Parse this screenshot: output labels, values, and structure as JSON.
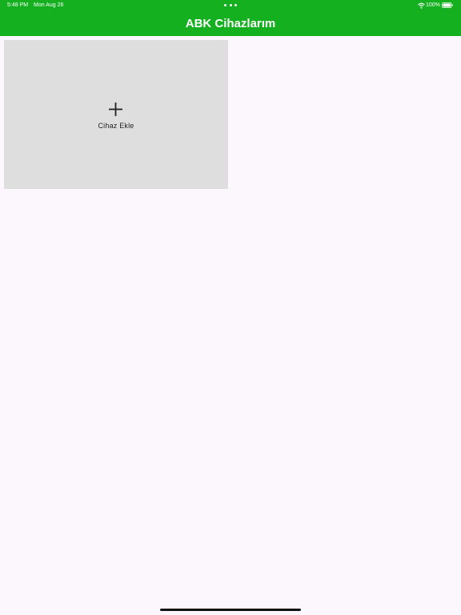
{
  "status_bar": {
    "time": "5:48 PM",
    "date": "Mon Aug 26",
    "battery": "100%",
    "wifi_icon": "wifi-icon",
    "battery_icon": "battery-icon"
  },
  "header": {
    "title": "ABK Cihazlarım",
    "color": "#14b01f"
  },
  "main": {
    "add_device_card": {
      "icon": "plus-icon",
      "label": "Cihaz Ekle",
      "color": "#dedede"
    }
  },
  "colors": {
    "background": "#fcf7fd",
    "accent": "#14b01f"
  }
}
